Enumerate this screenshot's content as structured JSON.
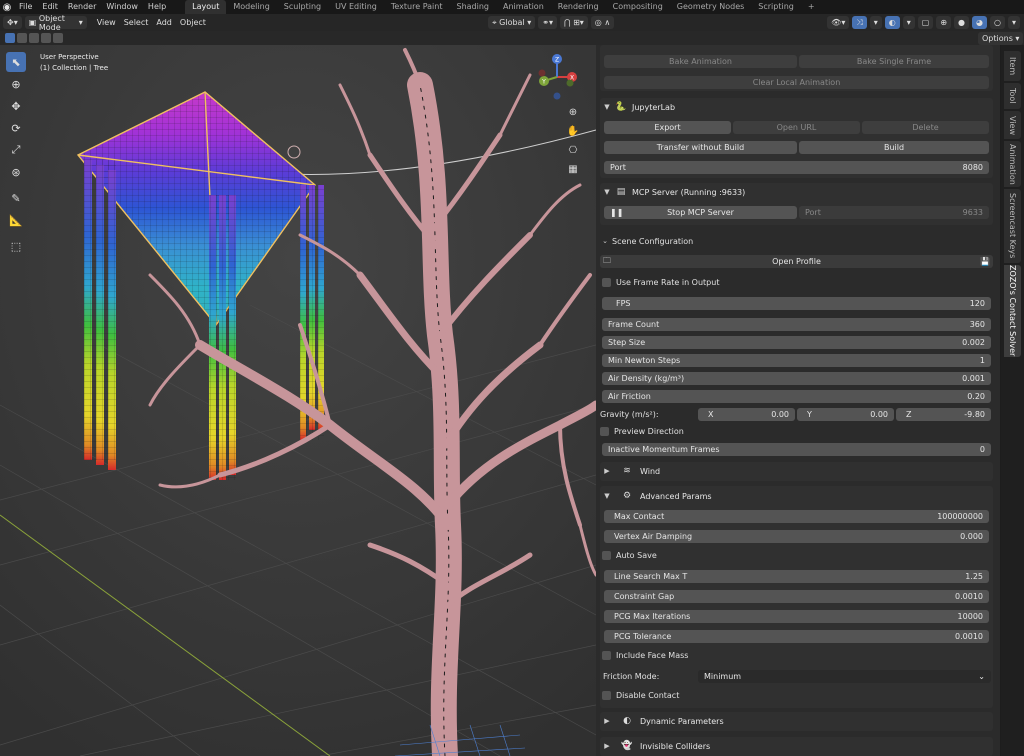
{
  "menu": {
    "items": [
      "File",
      "Edit",
      "Render",
      "Window",
      "Help"
    ]
  },
  "workspaces": [
    "Layout",
    "Modeling",
    "Sculpting",
    "UV Editing",
    "Texture Paint",
    "Shading",
    "Animation",
    "Rendering",
    "Compositing",
    "Geometry Nodes",
    "Scripting"
  ],
  "workspace_add": "+",
  "header": {
    "mode": "Object Mode",
    "menus": [
      "View",
      "Select",
      "Add",
      "Object"
    ],
    "transform_orientation": "Global",
    "options": "Options"
  },
  "viewport": {
    "perspective": "User Perspective",
    "collection": "(1) Collection | Tree",
    "gizmo_axes": {
      "x": "X",
      "y": "Y",
      "z": "Z"
    }
  },
  "tabs": [
    "Item",
    "Tool",
    "View",
    "Animation",
    "Screencast Keys",
    "ZOZO's Contact Solver"
  ],
  "animation": {
    "bake_animation": "Bake Animation",
    "bake_single_frame": "Bake Single Frame",
    "clear_local": "Clear Local Animation"
  },
  "jupyter": {
    "title": "JupyterLab",
    "export": "Export",
    "open_url": "Open URL",
    "delete": "Delete",
    "transfer": "Transfer without Build",
    "build": "Build",
    "port_label": "Port",
    "port_value": "8080"
  },
  "mcp": {
    "title": "MCP Server (Running :9633)",
    "stop": "Stop MCP Server",
    "port_label": "Port",
    "port_value": "9633"
  },
  "scene": {
    "title": "Scene Configuration",
    "open_profile": "Open Profile",
    "use_frame_rate": "Use Frame Rate in Output",
    "fps_label": "FPS",
    "fps_value": "120",
    "frame_count_label": "Frame Count",
    "frame_count_value": "360",
    "step_size_label": "Step Size",
    "step_size_value": "0.002",
    "newton_label": "Min Newton Steps",
    "newton_value": "1",
    "air_density_label": "Air Density (kg/m³)",
    "air_density_value": "0.001",
    "air_friction_label": "Air Friction",
    "air_friction_value": "0.20",
    "gravity_label": "Gravity (m/s²):",
    "gravity": {
      "x_label": "X",
      "x": "0.00",
      "y_label": "Y",
      "y": "0.00",
      "z_label": "Z",
      "z": "-9.80"
    },
    "preview_direction": "Preview Direction",
    "inactive_label": "Inactive Momentum Frames",
    "inactive_value": "0"
  },
  "wind": {
    "title": "Wind"
  },
  "advanced": {
    "title": "Advanced Params",
    "max_contact_label": "Max Contact",
    "max_contact_value": "100000000",
    "vertex_air_label": "Vertex Air Damping",
    "vertex_air_value": "0.000",
    "auto_save": "Auto Save",
    "line_search_label": "Line Search Max T",
    "line_search_value": "1.25",
    "constraint_gap_label": "Constraint Gap",
    "constraint_gap_value": "0.0010",
    "pcg_iter_label": "PCG Max Iterations",
    "pcg_iter_value": "10000",
    "pcg_tol_label": "PCG Tolerance",
    "pcg_tol_value": "0.0010",
    "include_face_mass": "Include Face Mass",
    "friction_mode_label": "Friction Mode:",
    "friction_mode_value": "Minimum",
    "disable_contact": "Disable Contact"
  },
  "dynamic": {
    "title": "Dynamic Parameters"
  },
  "colliders": {
    "title": "Invisible Colliders"
  },
  "colors": {
    "accent": "#4772b3",
    "panel": "#303030",
    "field": "#545454",
    "viewport": "#3a3a3a"
  }
}
